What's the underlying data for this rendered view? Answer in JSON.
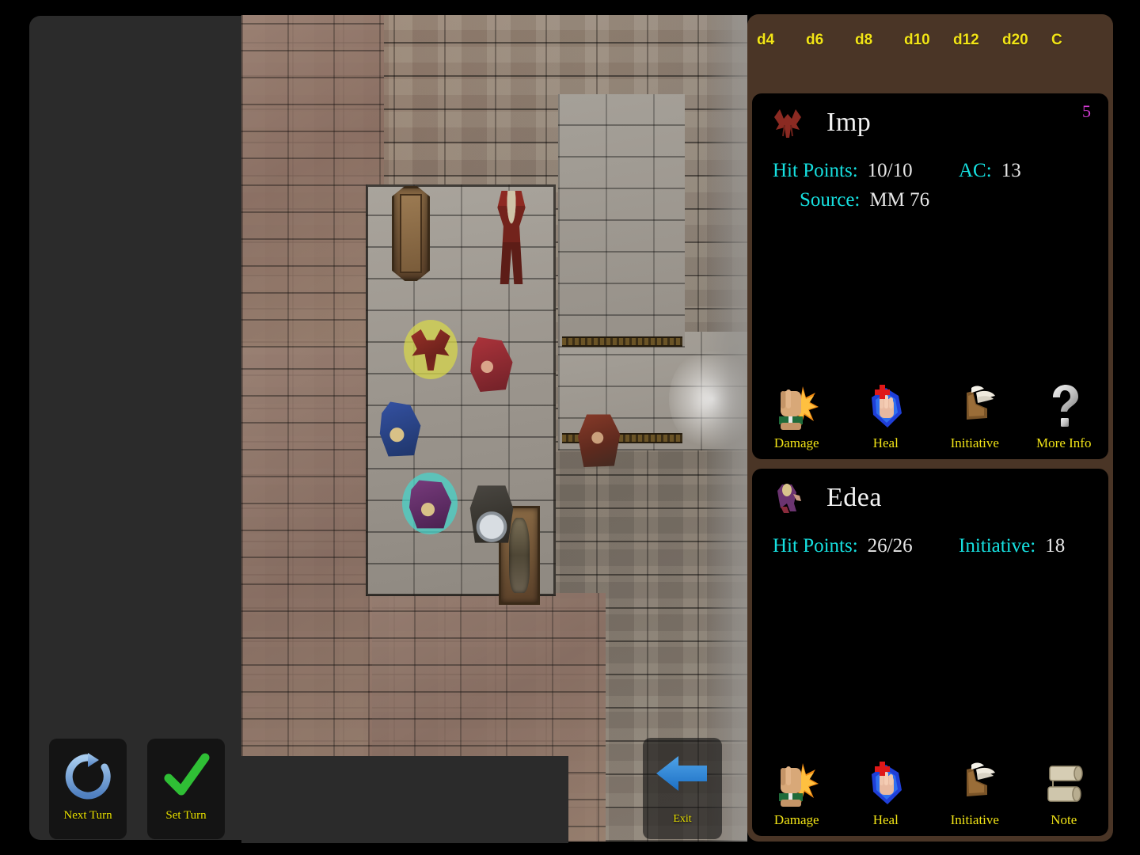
{
  "dice_bar": {
    "buttons": [
      {
        "label": "d4",
        "name": "dice-d4"
      },
      {
        "label": "d6",
        "name": "dice-d6"
      },
      {
        "label": "d8",
        "name": "dice-d8"
      },
      {
        "label": "d10",
        "name": "dice-d10"
      },
      {
        "label": "d12",
        "name": "dice-d12"
      },
      {
        "label": "d20",
        "name": "dice-d20"
      },
      {
        "label": "C",
        "name": "dice-clear"
      }
    ]
  },
  "colors": {
    "dice_label": "#f2e416",
    "sidebar_brown": "#4a3526",
    "card_black": "#000000",
    "stat_label_cyan": "#16e0e0",
    "stat_value": "#e6e6e6",
    "badge_magenta": "#d43ad4",
    "caption_yellow": "#f2e416",
    "left_panel": "#2b2b2b",
    "imp_highlight": "#d8d84a",
    "edea_highlight": "#46d6cc"
  },
  "cards": [
    {
      "name": "Imp",
      "avatar_icon": "imp-token-icon",
      "badge": "5",
      "stats": [
        {
          "label": "Hit Points:",
          "value": "10/10"
        },
        {
          "label": "AC:",
          "value": "13"
        },
        {
          "label": "Source:",
          "value": "MM 76"
        }
      ],
      "actions": [
        {
          "label": "Damage",
          "icon": "fist-burst-icon"
        },
        {
          "label": "Heal",
          "icon": "healing-hand-icon"
        },
        {
          "label": "Initiative",
          "icon": "winged-boot-icon"
        },
        {
          "label": "More Info",
          "icon": "question-mark-icon"
        }
      ]
    },
    {
      "name": "Edea",
      "avatar_icon": "edea-token-icon",
      "badge": "",
      "stats": [
        {
          "label": "Hit Points:",
          "value": "26/26"
        },
        {
          "label": "Initiative:",
          "value": "18"
        }
      ],
      "actions": [
        {
          "label": "Damage",
          "icon": "fist-burst-icon"
        },
        {
          "label": "Heal",
          "icon": "healing-hand-icon"
        },
        {
          "label": "Initiative",
          "icon": "winged-boot-icon"
        },
        {
          "label": "Note",
          "icon": "scroll-icon"
        }
      ]
    }
  ],
  "turn_controls": [
    {
      "label": "Next Turn",
      "icon": "refresh-circle-arrow-icon"
    },
    {
      "label": "Set Turn",
      "icon": "green-checkmark-icon"
    }
  ],
  "exit": {
    "label": "Exit",
    "icon": "left-arrow-icon"
  },
  "map": {
    "tokens": [
      {
        "name": "skeleton-warrior-token",
        "highlight": "none"
      },
      {
        "name": "imp-token",
        "highlight": "yellow"
      },
      {
        "name": "red-cloaked-rogue-token",
        "highlight": "none"
      },
      {
        "name": "blue-robed-mage-token",
        "highlight": "none"
      },
      {
        "name": "edea-token",
        "highlight": "teal"
      },
      {
        "name": "shield-fighter-token",
        "highlight": "none"
      },
      {
        "name": "crossbow-guard-token",
        "highlight": "none"
      }
    ],
    "props": [
      {
        "name": "closed-coffin"
      },
      {
        "name": "open-coffin-with-mummy"
      }
    ]
  }
}
